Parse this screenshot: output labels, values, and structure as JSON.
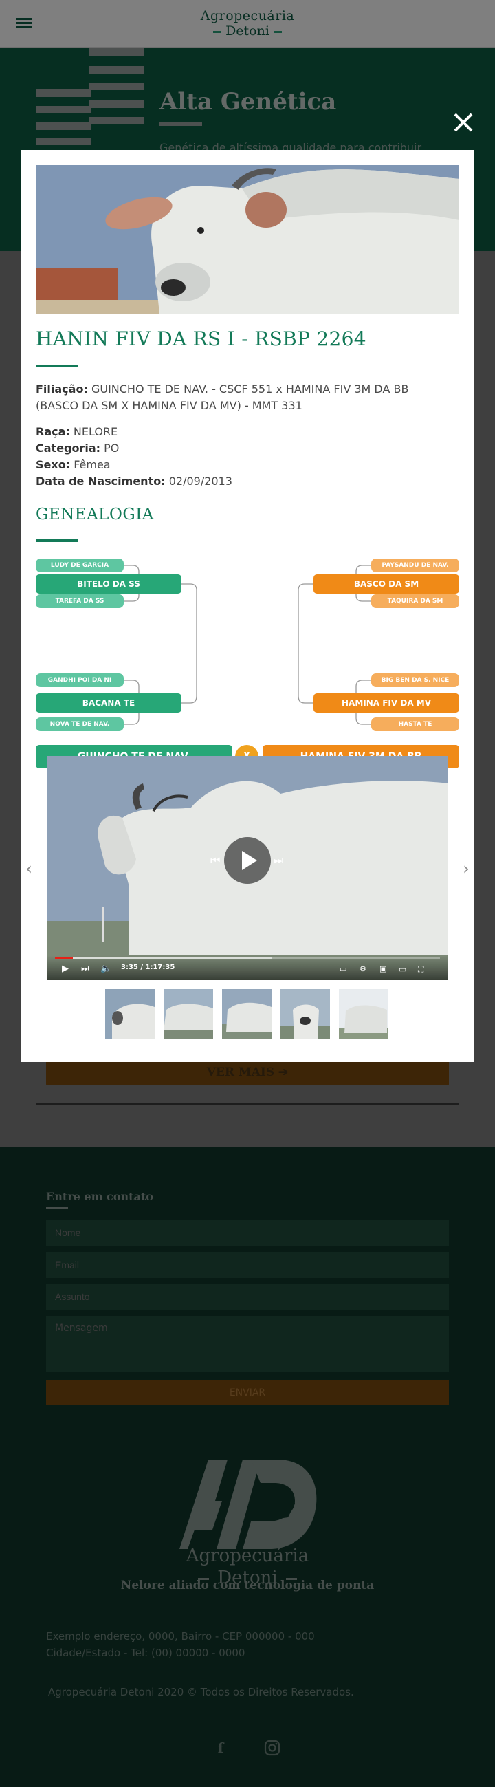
{
  "header": {
    "brand_line1": "Agropecuária",
    "brand_line2": "Detoni"
  },
  "hero": {
    "title": "Alta Genética",
    "subtitle": "Genética de altíssima qualidade para contribuir"
  },
  "page": {
    "ver_mais_label": "VER MAIS ➔"
  },
  "modal": {
    "close_label": "close",
    "title": "HANIN FIV DA RS I - RSBP 2264",
    "filiacao_label": "Filiação:",
    "filiacao_value": "GUINCHO TE DE NAV. - CSCF 551 x HAMINA FIV 3M DA BB (BASCO DA SM X HAMINA FIV DA MV) - MMT 331",
    "specs": [
      {
        "label": "Raça:",
        "value": "NELORE"
      },
      {
        "label": "Categoria:",
        "value": "PO"
      },
      {
        "label": "Sexo:",
        "value": "Fêmea"
      },
      {
        "label": "Data de Nascimento:",
        "value": "02/09/2013"
      }
    ],
    "genealogy_title": "GENEALOGIA",
    "genealogy": {
      "sire": "GUINCHO TE DE NAV.",
      "dam": "HAMINA FIV 3M DA BB",
      "cross": "X",
      "sire_sire": "BITELO DA SS",
      "sire_dam": "BACANA TE",
      "sire_sire_sire": "LUDY DE GARCIA",
      "sire_sire_dam": "TAREFA DA SS",
      "sire_dam_sire": "GANDHI POI DA NI",
      "sire_dam_dam": "NOVA TE DE NAV.",
      "dam_sire": "BASCO DA SM",
      "dam_dam": "HAMINA FIV DA MV",
      "dam_sire_sire": "PAYSANDU DE NAV.",
      "dam_sire_dam": "TAQUIRA DA SM",
      "dam_dam_sire": "BIG BEN DA S. NICE",
      "dam_dam_dam": "HASTA TE"
    },
    "video": {
      "time": "3:35 / 1:17:35",
      "progress": 0.046
    },
    "thumbnail_count": 5
  },
  "footer": {
    "contact_title": "Entre em contato",
    "name_placeholder": "Nome",
    "email_placeholder": "Email",
    "subject_placeholder": "Assunto",
    "message_placeholder": "Mensagem",
    "send_label": "ENVIAR",
    "logo_line1": "Agropecuária",
    "logo_line2": "Detoni",
    "tagline": "Nelore aliado com tecnologia de ponta",
    "address1": "Exemplo endereço, 0000, Bairro - CEP 000000 - 000",
    "address2": "Cidade/Estado - Tel: (00) 00000 - 0000",
    "copyright": "Agropecuária Detoni 2020 © Todos os Direitos Reservados."
  },
  "colors": {
    "green": "#137a58",
    "green_node": "#27a777",
    "orange_node": "#f08a17",
    "footer_bg": "#10372b",
    "hero_bg": "#0d5c43"
  }
}
